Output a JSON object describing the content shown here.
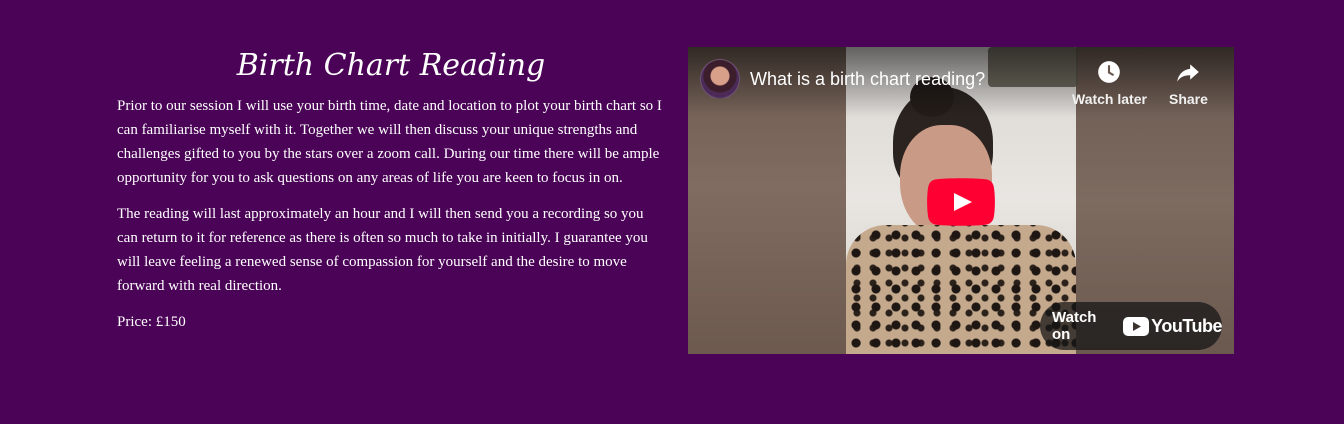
{
  "section": {
    "title": "Birth Chart Reading",
    "paragraphs": [
      "Prior to our session I will use your birth time, date and location to plot your birth chart so I can familiarise myself with it. Together we will then discuss your unique strengths and challenges gifted to you by the stars over a zoom call. During our time there will be ample opportunity for you to ask questions on any areas of life you are keen to focus in on.",
      "The reading will last approximately an hour and I will then send you a recording so you can return to it for reference as there is often so much to take in initially. I guarantee you will leave feeling a renewed sense of compassion for yourself and the desire to move forward with real direction."
    ],
    "price": "Price: £150"
  },
  "video": {
    "title": "What is a birth chart reading?",
    "watch_later_label": "Watch later",
    "share_label": "Share",
    "watch_on_label": "Watch on",
    "youtube_label": "YouTube",
    "icons": {
      "watch_later": "clock-icon",
      "share": "share-arrow-icon",
      "play": "play-icon",
      "channel": "channel-avatar",
      "youtube": "youtube-logo-icon"
    }
  },
  "colors": {
    "background": "#4a0356",
    "text": "#ffffff",
    "youtube_red": "#ff0033"
  }
}
